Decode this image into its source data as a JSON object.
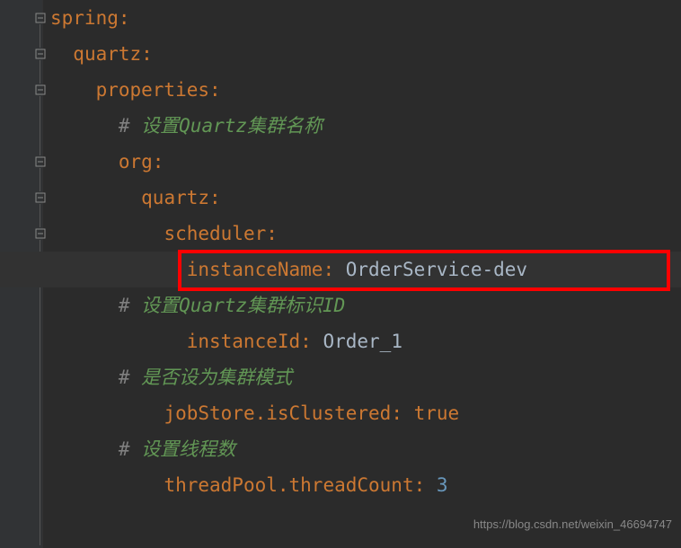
{
  "code": {
    "l1_key": "spring",
    "l2_key": "quartz",
    "l3_key": "properties",
    "l4_comment_prefix": "# ",
    "l4_comment_text1": "设置",
    "l4_comment_text2": "Quartz",
    "l4_comment_text3": "集群名称",
    "l5_key": "org",
    "l6_key": "quartz",
    "l7_key": "scheduler",
    "l8_key": "instanceName",
    "l8_value": "OrderService-dev",
    "l9_comment_prefix": "# ",
    "l9_comment_text1": "设置",
    "l9_comment_text2": "Quartz",
    "l9_comment_text3": "集群标识",
    "l9_comment_text4": "ID",
    "l10_key": "instanceId",
    "l10_value": "Order_1",
    "l11_comment_prefix": "# ",
    "l11_comment_text": "是否设为集群模式",
    "l12_key": "jobStore.isClustered",
    "l12_value": "true",
    "l13_comment_prefix": "# ",
    "l13_comment_text": "设置线程数",
    "l14_key": "threadPool.threadCount",
    "l14_value": "3"
  },
  "watermark": "https://blog.csdn.net/weixin_46694747"
}
